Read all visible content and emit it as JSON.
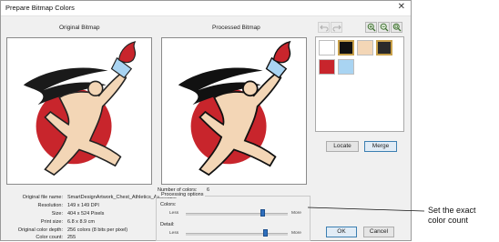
{
  "dialog": {
    "title": "Prepare Bitmap Colors",
    "close_glyph": "✕"
  },
  "labels": {
    "original": "Original Bitmap",
    "processed": "Processed Bitmap"
  },
  "toolbar": {
    "icons": [
      "undo-icon",
      "redo-icon",
      "zoom-in-icon",
      "zoom-out-icon",
      "zoom-fit-icon"
    ]
  },
  "swatches": [
    {
      "color": "#ffffff",
      "selected": false
    },
    {
      "color": "#111111",
      "selected": true
    },
    {
      "color": "#f3d6b6",
      "selected": false
    },
    {
      "color": "#2a2a2a",
      "selected": true
    },
    {
      "color": "#c8252c",
      "selected": false
    },
    {
      "color": "#a9d4f2",
      "selected": false
    }
  ],
  "buttons": {
    "locate": "Locate",
    "merge": "Merge",
    "ok": "OK",
    "cancel": "Cancel"
  },
  "info": {
    "file_name_label": "Original file name:",
    "file_name_value": "SmartDesignArtwork_Chest_Athletics_Associatio",
    "resolution_label": "Resolution:",
    "resolution_value": "149 x 149 DPI",
    "size_label": "Size:",
    "size_value": "404 x 524 Pixels",
    "print_size_label": "Print size:",
    "print_size_value": "6.8 x 8.9 cm",
    "color_depth_label": "Original color depth:",
    "color_depth_value": "256 colors (8 bits per pixel)",
    "color_count_label": "Color count:",
    "color_count_value": "255"
  },
  "processing": {
    "number_of_colors_label": "Number of colors:",
    "number_of_colors_value": "6",
    "group_title": "Processing options",
    "colors_label": "Colors:",
    "detail_label": "Detail:",
    "less": "Less",
    "more": "More",
    "colors_level": 0.75,
    "detail_level": 0.78
  },
  "annotation": {
    "line1": "Set the exact",
    "line2": "color count"
  }
}
